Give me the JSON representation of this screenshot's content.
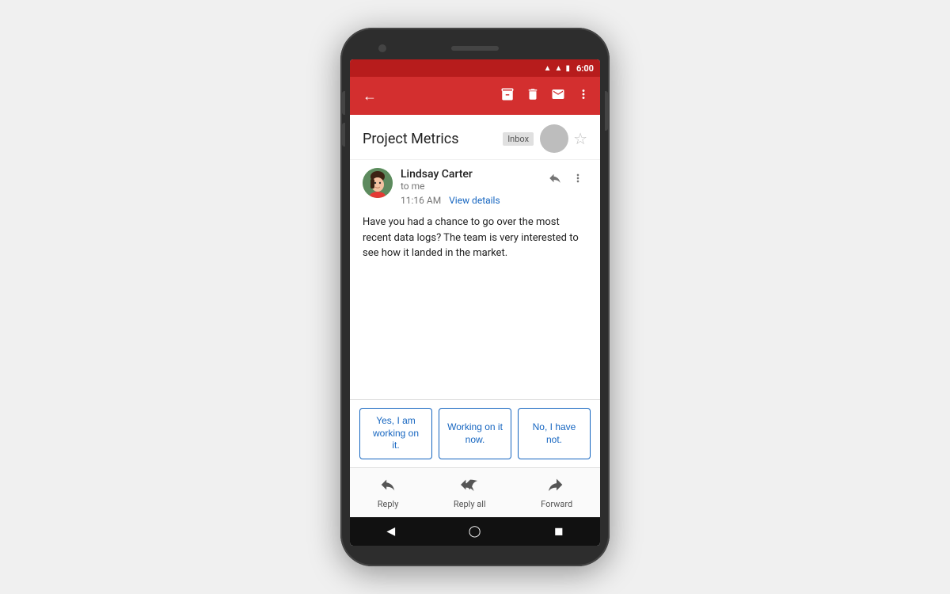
{
  "status_bar": {
    "time": "6:00",
    "wifi_icon": "▲",
    "signal_icon": "▲",
    "battery_icon": "▮"
  },
  "app_bar": {
    "back_icon": "←",
    "icons": [
      "archive",
      "delete",
      "mail",
      "more_vert"
    ]
  },
  "email_header": {
    "subject": "Project Metrics",
    "badge": "Inbox",
    "star_icon": "☆"
  },
  "sender": {
    "name": "Lindsay Carter",
    "to": "to me",
    "time": "11:16 AM",
    "view_details": "View details",
    "reply_icon": "↩",
    "more_icon": "⋮"
  },
  "email_body": "Have you had a chance to go over the most recent data logs? The team is very interested to see how it landed in the market.",
  "smart_replies": [
    {
      "label": "Yes, I am working on it."
    },
    {
      "label": "Working on it now."
    },
    {
      "label": "No, I have not."
    }
  ],
  "bottom_actions": [
    {
      "icon": "↩",
      "label": "Reply"
    },
    {
      "icon": "↩↩",
      "label": "Reply all"
    },
    {
      "icon": "→",
      "label": "Forward"
    }
  ],
  "nav_bar": {
    "back": "◀",
    "home": "◯",
    "recents": "◼"
  }
}
